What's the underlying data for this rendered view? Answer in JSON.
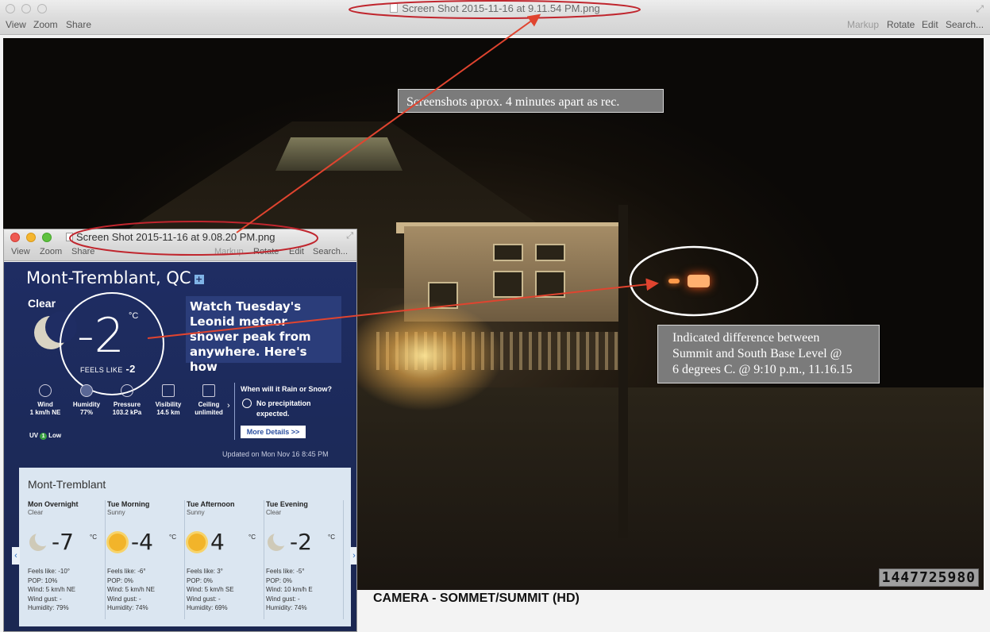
{
  "window": {
    "title": "Screen Shot 2015-11-16 at 9.11.54 PM.png",
    "toolbar_left": [
      "View",
      "Zoom",
      "Share"
    ],
    "toolbar_right": [
      "Markup",
      "Rotate",
      "Edit",
      "Search..."
    ]
  },
  "photo": {
    "timestamp": "1447725980",
    "caption": "CAMERA - SOMMET/SUMMIT (HD)"
  },
  "annotations": {
    "note_top": "Screenshots aprox. 4 minutes apart as rec.",
    "note_right_lines": [
      "Indicated difference between",
      "Summit and South Base Level @",
      "6 degrees C. @ 9:10 p.m., 11.16.15"
    ],
    "colors": {
      "ellipse_red": "#c0262e",
      "ellipse_white": "#ffffff",
      "arrow": "#e0442f"
    }
  },
  "inner_window": {
    "title": "Screen Shot 2015-11-16 at 9.08.20 PM.png",
    "toolbar_left": [
      "View",
      "Zoom",
      "Share"
    ],
    "toolbar_right": [
      "Markup",
      "Rotate",
      "Edit",
      "Search..."
    ]
  },
  "weather": {
    "city": "Mont-Tremblant, QC",
    "condition": "Clear",
    "temp": "-2",
    "unit": "°C",
    "feels_like_label": "FEELS LIKE",
    "feels_like_value": "-2",
    "promo": "Watch Tuesday's Leonid meteor shower peak from anywhere. Here's how",
    "stats": [
      {
        "icon": "wind-icon",
        "label": "Wind",
        "value": "1 km/h NE"
      },
      {
        "icon": "humidity-icon",
        "label": "Humidity",
        "value": "77%"
      },
      {
        "icon": "pressure-icon",
        "label": "Pressure",
        "value": "103.2 kPa"
      },
      {
        "icon": "visibility-icon",
        "label": "Visibility",
        "value": "14.5 km"
      },
      {
        "icon": "ceiling-icon",
        "label": "Ceiling",
        "value": "unlimited"
      }
    ],
    "rain_question": "When will it Rain or Snow?",
    "no_precip_line1": "No precipitation",
    "no_precip_line2": "expected.",
    "more_details": "More Details >>",
    "uv_label": "UV",
    "uv_index": "1",
    "uv_level": "Low",
    "updated": "Updated on Mon Nov 16 8:45 PM",
    "forecast_title": "Mont-Tremblant",
    "forecast": [
      {
        "period": "Mon Overnight",
        "cond": "Clear",
        "icon": "moon-icon",
        "temp": "-7",
        "unit": "°C",
        "feels": "Feels like: -10°",
        "pop": "POP: 10%",
        "wind": "Wind: 5 km/h NE",
        "gust": "Wind gust: -",
        "humidity": "Humidity: 79%"
      },
      {
        "period": "Tue Morning",
        "cond": "Sunny",
        "icon": "sun-icon",
        "temp": "-4",
        "unit": "°C",
        "feels": "Feels like: -6°",
        "pop": "POP: 0%",
        "wind": "Wind: 5 km/h NE",
        "gust": "Wind gust: -",
        "humidity": "Humidity: 74%"
      },
      {
        "period": "Tue Afternoon",
        "cond": "Sunny",
        "icon": "sun-icon",
        "temp": "4",
        "unit": "°C",
        "feels": "Feels like: 3°",
        "pop": "POP: 0%",
        "wind": "Wind: 5 km/h SE",
        "gust": "Wind gust: -",
        "humidity": "Humidity: 69%"
      },
      {
        "period": "Tue Evening",
        "cond": "Clear",
        "icon": "moon-icon",
        "temp": "-2",
        "unit": "°C",
        "feels": "Feels like: -5°",
        "pop": "POP: 0%",
        "wind": "Wind: 10 km/h E",
        "gust": "Wind gust: -",
        "humidity": "Humidity: 74%"
      }
    ]
  }
}
